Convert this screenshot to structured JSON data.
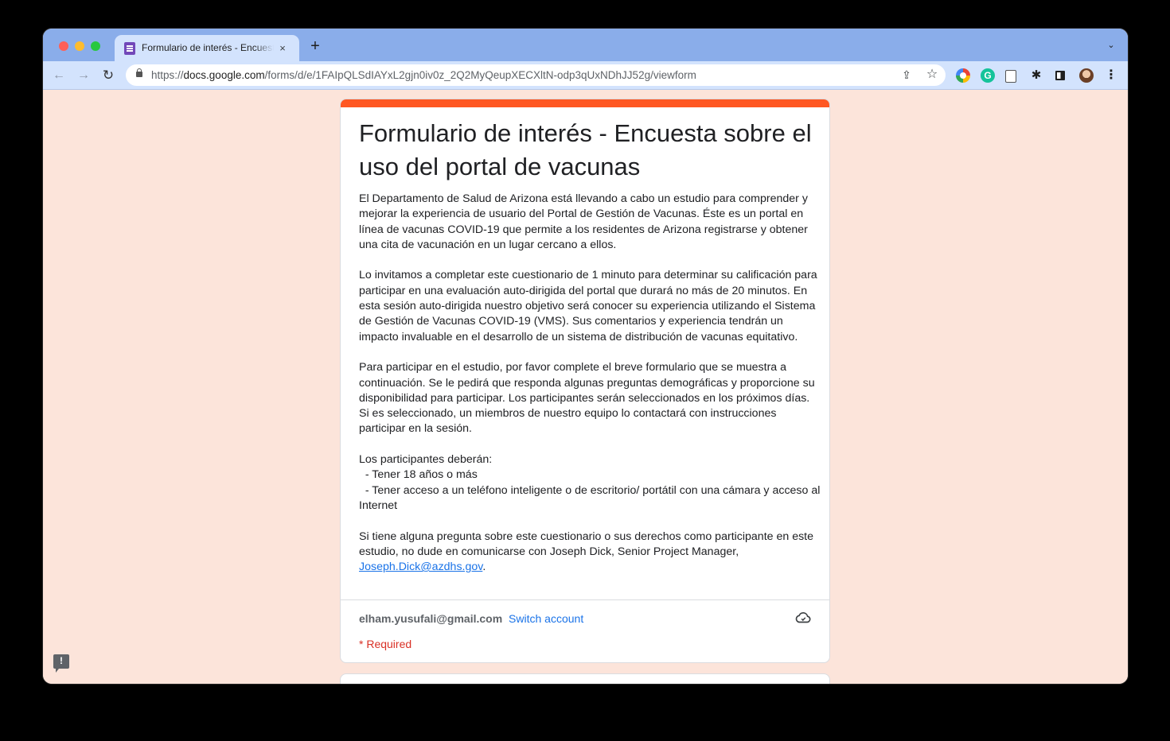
{
  "browser": {
    "tab_title": "Formulario de interés - Encuesta sobre el uso del portal de vacunas",
    "tab_close": "×",
    "new_tab": "+",
    "tab_search": "⌄",
    "back": "←",
    "forward": "→",
    "reload": "↻",
    "url_scheme": "https://",
    "url_host": "docs.google.com",
    "url_path": "/forms/d/e/1FAIpQLSdIAYxL2gjn0iv0z_2Q2MyQeupXECXltN-odp3qUxNDhJJ52g/viewform",
    "share": "⇪",
    "star": "☆",
    "ext_grammarly": "G",
    "ext_puzzle": "✱",
    "menu": "⋮"
  },
  "form": {
    "title": "Formulario de interés - Encuesta sobre el uso del portal de vacunas",
    "description": "El Departamento de Salud de Arizona está llevando a cabo un estudio para comprender y mejorar la experiencia de usuario del Portal de Gestión de Vacunas. Éste es un portal en línea de vacunas COVID-19 que permite a los residentes de Arizona registrarse y obtener una cita de vacunación en un lugar cercano a ellos.\n\nLo invitamos a completar este cuestionario de 1 minuto para determinar su calificación para participar en una evaluación auto-dirigida del portal que durará no más de 20 minutos. En esta sesión auto-dirigida nuestro objetivo será conocer su experiencia utilizando el Sistema de Gestión de Vacunas COVID-19 (VMS). Sus comentarios y experiencia tendrán un impacto invaluable en el desarrollo de un sistema de distribución de vacunas equitativo.\n\nPara participar en el estudio, por favor complete el breve formulario que se muestra a continuación. Se le pedirá que responda algunas preguntas demográficas y proporcione su disponibilidad para participar. Los participantes serán seleccionados en los próximos días. Si es seleccionado, un miembros de nuestro equipo lo contactará con instrucciones participar en la sesión.\n\nLos participantes deberán:\n  - Tener 18 años o más\n  - Tener acceso a un teléfono inteligente o de escritorio/ portátil con una cámara y acceso al Internet\n\nSi tiene alguna pregunta sobre este cuestionario o sus derechos como participante en este estudio, no dude en comunicarse con Joseph Dick, Senior Project Manager, ",
    "contact_email": "Joseph.Dick@azdhs.gov",
    "after_email": ".",
    "account_email": "elham.yusufali@gmail.com",
    "switch_account": "Switch account",
    "required_note": "* Required",
    "feedback_icon": "!"
  },
  "colors": {
    "page_background": "#fce4da",
    "accent": "#ff5722",
    "link": "#1a73e8",
    "required": "#d93025"
  }
}
